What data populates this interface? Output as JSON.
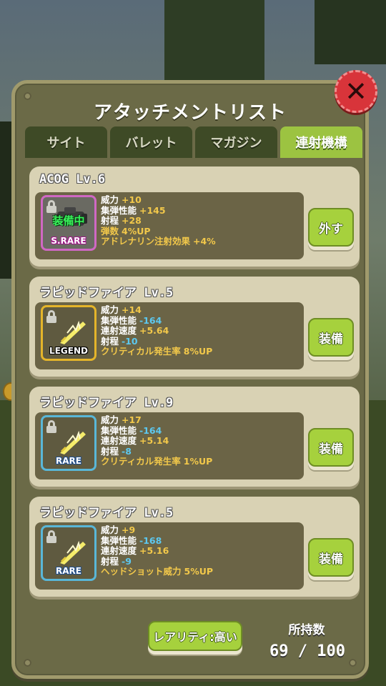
{
  "title": "アタッチメントリスト",
  "tabs": [
    {
      "label": "サイト",
      "active": false
    },
    {
      "label": "バレット",
      "active": false
    },
    {
      "label": "マガジン",
      "active": false
    },
    {
      "label": "連射機構",
      "active": true
    }
  ],
  "items": [
    {
      "name": "ACOG Lv.6",
      "rarity": "S.RARE",
      "equipped_label": "装備中",
      "icon": "scope-icon",
      "stats": [
        {
          "label": "威力",
          "value": "+10",
          "kind": "pos"
        },
        {
          "label": "集弾性能",
          "value": "+145",
          "kind": "pos"
        },
        {
          "label": "射程",
          "value": "+28",
          "kind": "pos"
        },
        {
          "label": "弾数",
          "value": "4%UP",
          "kind": "perk"
        },
        {
          "label": "アドレナリン注射効果",
          "value": "+4%",
          "kind": "perk"
        }
      ],
      "button_label": "外す"
    },
    {
      "name": "ラピッドファイア Lv.5",
      "rarity": "LEGEND",
      "icon": "feather-bolt-icon",
      "stats": [
        {
          "label": "威力",
          "value": "+14",
          "kind": "pos"
        },
        {
          "label": "集弾性能",
          "value": "-164",
          "kind": "neg"
        },
        {
          "label": "連射速度",
          "value": "+5.64",
          "kind": "pos"
        },
        {
          "label": "射程",
          "value": "-10",
          "kind": "neg"
        },
        {
          "label": "クリティカル発生率",
          "value": "8%UP",
          "kind": "perk"
        }
      ],
      "button_label": "装備"
    },
    {
      "name": "ラピッドファイア Lv.9",
      "rarity": "RARE",
      "icon": "feather-bolt-icon",
      "stats": [
        {
          "label": "威力",
          "value": "+17",
          "kind": "pos"
        },
        {
          "label": "集弾性能",
          "value": "-164",
          "kind": "neg"
        },
        {
          "label": "連射速度",
          "value": "+5.14",
          "kind": "pos"
        },
        {
          "label": "射程",
          "value": "-8",
          "kind": "neg"
        },
        {
          "label": "クリティカル発生率",
          "value": "1%UP",
          "kind": "perk"
        }
      ],
      "button_label": "装備"
    },
    {
      "name": "ラピッドファイア Lv.5",
      "rarity": "RARE",
      "icon": "feather-bolt-icon",
      "stats": [
        {
          "label": "威力",
          "value": "+9",
          "kind": "pos"
        },
        {
          "label": "集弾性能",
          "value": "-168",
          "kind": "neg"
        },
        {
          "label": "連射速度",
          "value": "+5.16",
          "kind": "pos"
        },
        {
          "label": "射程",
          "value": "-9",
          "kind": "neg"
        },
        {
          "label": "ヘッドショット威力",
          "value": "5%UP",
          "kind": "perk"
        }
      ],
      "button_label": "装備"
    }
  ],
  "footer": {
    "sort_button_label": "レアリティ:高い",
    "owned_label": "所持数",
    "owned_count": "69 / 100"
  },
  "colors": {
    "panel": "#6b6a47",
    "active_tab": "#9cc341",
    "inactive_tab": "#3e4a26",
    "button_green": "#a6d13d",
    "card": "#d9d2b4",
    "close_red": "#d8343a",
    "positive_stat": "#f2c84a",
    "negative_stat": "#5cc8f0"
  }
}
